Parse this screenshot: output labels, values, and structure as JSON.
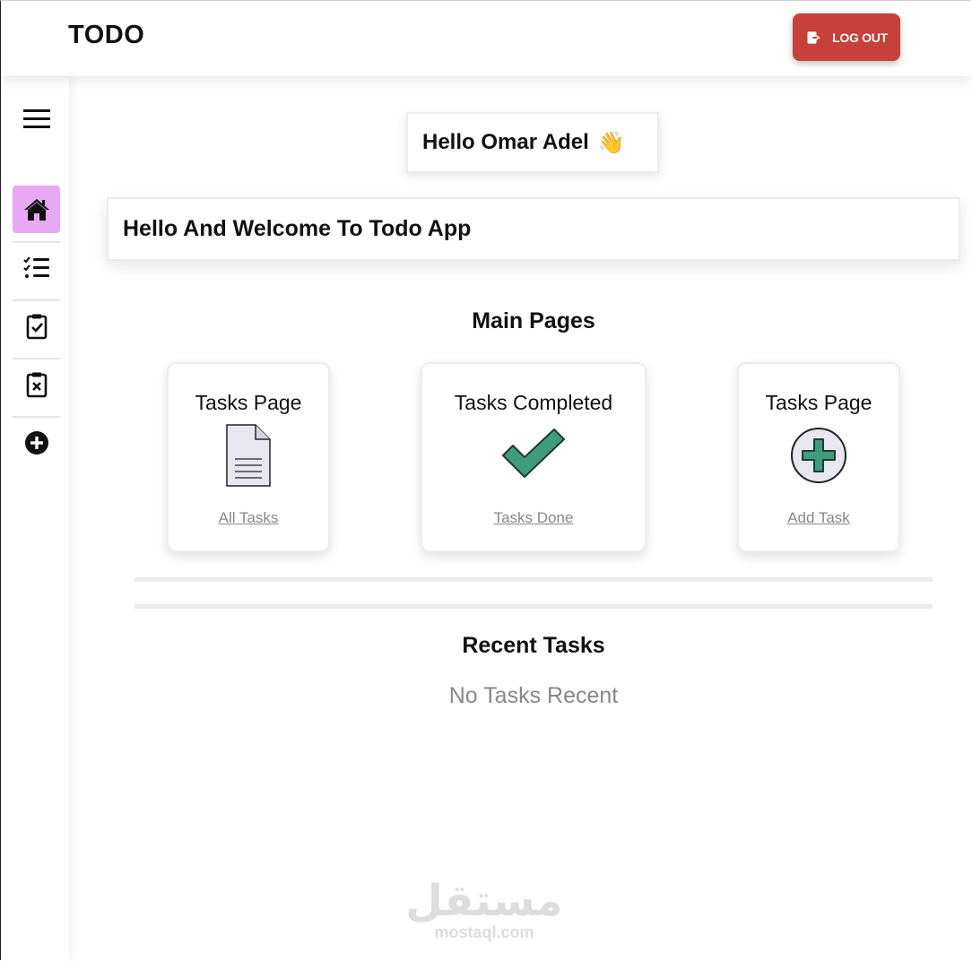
{
  "header": {
    "brand": "TODO",
    "logout_label": "LOG OUT",
    "logout_color": "#c7403a"
  },
  "sidebar": {
    "items": [
      {
        "icon": "menu-icon"
      },
      {
        "icon": "home-icon",
        "active": true,
        "active_color": "#e9a8f6"
      },
      {
        "icon": "task-list-icon"
      },
      {
        "icon": "clipboard-check-icon"
      },
      {
        "icon": "clipboard-x-icon"
      },
      {
        "icon": "add-circle-icon"
      }
    ]
  },
  "main": {
    "greeting": "Hello Omar Adel",
    "greeting_emoji": "👋",
    "welcome": "Hello And Welcome To Todo App",
    "main_pages_title": "Main Pages",
    "cards": [
      {
        "title": "Tasks Page",
        "icon": "document-icon",
        "link": "All Tasks"
      },
      {
        "title": "Tasks Completed",
        "icon": "checkmark-icon",
        "link": "Tasks Done"
      },
      {
        "title": "Tasks Page",
        "icon": "plus-circle-icon",
        "link": "Add Task"
      }
    ],
    "recent_title": "Recent Tasks",
    "recent_empty": "No Tasks Recent",
    "accent_green": "#3f9c7d"
  },
  "watermark": {
    "arabic": "مستقل",
    "latin": "mostaql.com"
  }
}
